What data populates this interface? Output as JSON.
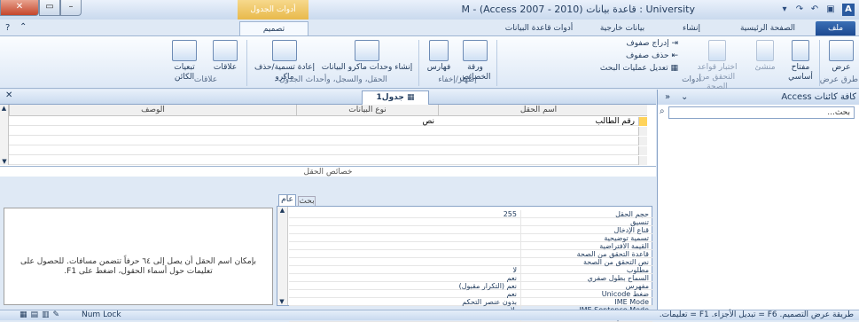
{
  "window": {
    "title": "M - (Access 2007 - 2010) قاعدة بيانات : University",
    "context_tab": "أدوات الجدول"
  },
  "tabs": [
    {
      "label": "ملف"
    },
    {
      "label": "الصفحة الرئيسية"
    },
    {
      "label": "إنشاء"
    },
    {
      "label": "بيانات خارجية"
    },
    {
      "label": "أدوات قاعدة البيانات"
    },
    {
      "label": "تصميم"
    }
  ],
  "ribbon": {
    "views": {
      "view_label": "عرض",
      "group": "طرق عرض"
    },
    "tools": {
      "primary_key": "مفتاح أساسي",
      "builder": "منشئ",
      "test_rules": "اختبار قواعد التحقق من الصحة",
      "insert_rows": "إدراج صفوف",
      "delete_rows": "حذف صفوف",
      "modify_lookups": "تعديل عمليات البحث",
      "group": "أدوات"
    },
    "show_hide": {
      "property_sheet": "ورقة الخصائص",
      "indexes": "فهارس",
      "group": "إظهار/إخفاء"
    },
    "field_events": {
      "create_macros": "إنشاء وحدات ماكرو البيانات",
      "rename_macro": "إعادة تسمية/حذف ماكرو",
      "group": "الحقل، والسجل، وأحداث الجدول"
    },
    "relationships": {
      "relationships": "علاقات",
      "dependencies": "تبعيات الكائن",
      "group": "علاقات"
    }
  },
  "nav_pane": {
    "title": "كافة كائنات Access",
    "search_placeholder": "بحث..."
  },
  "document": {
    "tab_label": "جدول1",
    "columns": [
      "اسم الحقل",
      "نوع البيانات",
      "الوصف"
    ],
    "rows": [
      {
        "field_name": "رقم الطالب",
        "data_type": "نص",
        "description": ""
      }
    ],
    "field_properties_title": "خصائص الحقل",
    "property_tabs": [
      "عام",
      "بحث"
    ],
    "help_text": "بإمكان اسم الحقل أن يصل إلى ٦٤ حرفاً تتضمن مسافات. للحصول على تعليمات حول أسماء الحقول، اضغط على F1.",
    "properties": [
      {
        "name": "حجم الحقل",
        "value": "255"
      },
      {
        "name": "تنسيق",
        "value": ""
      },
      {
        "name": "قناع الإدخال",
        "value": ""
      },
      {
        "name": "تسمية توضيحية",
        "value": ""
      },
      {
        "name": "القيمة الافتراضية",
        "value": ""
      },
      {
        "name": "قاعدة التحقق من الصحة",
        "value": ""
      },
      {
        "name": "نص التحقق من الصحة",
        "value": ""
      },
      {
        "name": "مطلوب",
        "value": "لا"
      },
      {
        "name": "السماح بطول صفري",
        "value": "نعم"
      },
      {
        "name": "مفهرس",
        "value": "نعم (التكرار مقبول)"
      },
      {
        "name": "ضغط Unicode",
        "value": "نعم"
      },
      {
        "name": "IME Mode",
        "value": "بدون عنصر التحكم"
      },
      {
        "name": "IME Sentence Mode",
        "value": "بلا"
      },
      {
        "name": "علامات ذكية",
        "value": ""
      }
    ]
  },
  "status_bar": {
    "text": "طريقة عرض التصميم. F6 = تبديل الأجزاء. F1 = تعليمات.",
    "num_lock": "Num Lock"
  }
}
